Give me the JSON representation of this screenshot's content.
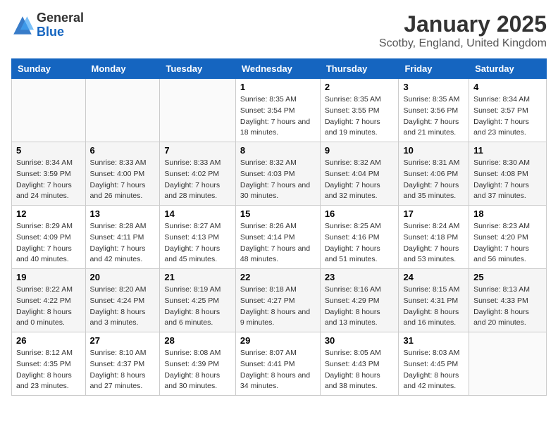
{
  "header": {
    "logo_general": "General",
    "logo_blue": "Blue",
    "title": "January 2025",
    "subtitle": "Scotby, England, United Kingdom"
  },
  "days_of_week": [
    "Sunday",
    "Monday",
    "Tuesday",
    "Wednesday",
    "Thursday",
    "Friday",
    "Saturday"
  ],
  "weeks": [
    [
      {
        "day": "",
        "sunrise": "",
        "sunset": "",
        "daylight": ""
      },
      {
        "day": "",
        "sunrise": "",
        "sunset": "",
        "daylight": ""
      },
      {
        "day": "",
        "sunrise": "",
        "sunset": "",
        "daylight": ""
      },
      {
        "day": "1",
        "sunrise": "Sunrise: 8:35 AM",
        "sunset": "Sunset: 3:54 PM",
        "daylight": "Daylight: 7 hours and 18 minutes."
      },
      {
        "day": "2",
        "sunrise": "Sunrise: 8:35 AM",
        "sunset": "Sunset: 3:55 PM",
        "daylight": "Daylight: 7 hours and 19 minutes."
      },
      {
        "day": "3",
        "sunrise": "Sunrise: 8:35 AM",
        "sunset": "Sunset: 3:56 PM",
        "daylight": "Daylight: 7 hours and 21 minutes."
      },
      {
        "day": "4",
        "sunrise": "Sunrise: 8:34 AM",
        "sunset": "Sunset: 3:57 PM",
        "daylight": "Daylight: 7 hours and 23 minutes."
      }
    ],
    [
      {
        "day": "5",
        "sunrise": "Sunrise: 8:34 AM",
        "sunset": "Sunset: 3:59 PM",
        "daylight": "Daylight: 7 hours and 24 minutes."
      },
      {
        "day": "6",
        "sunrise": "Sunrise: 8:33 AM",
        "sunset": "Sunset: 4:00 PM",
        "daylight": "Daylight: 7 hours and 26 minutes."
      },
      {
        "day": "7",
        "sunrise": "Sunrise: 8:33 AM",
        "sunset": "Sunset: 4:02 PM",
        "daylight": "Daylight: 7 hours and 28 minutes."
      },
      {
        "day": "8",
        "sunrise": "Sunrise: 8:32 AM",
        "sunset": "Sunset: 4:03 PM",
        "daylight": "Daylight: 7 hours and 30 minutes."
      },
      {
        "day": "9",
        "sunrise": "Sunrise: 8:32 AM",
        "sunset": "Sunset: 4:04 PM",
        "daylight": "Daylight: 7 hours and 32 minutes."
      },
      {
        "day": "10",
        "sunrise": "Sunrise: 8:31 AM",
        "sunset": "Sunset: 4:06 PM",
        "daylight": "Daylight: 7 hours and 35 minutes."
      },
      {
        "day": "11",
        "sunrise": "Sunrise: 8:30 AM",
        "sunset": "Sunset: 4:08 PM",
        "daylight": "Daylight: 7 hours and 37 minutes."
      }
    ],
    [
      {
        "day": "12",
        "sunrise": "Sunrise: 8:29 AM",
        "sunset": "Sunset: 4:09 PM",
        "daylight": "Daylight: 7 hours and 40 minutes."
      },
      {
        "day": "13",
        "sunrise": "Sunrise: 8:28 AM",
        "sunset": "Sunset: 4:11 PM",
        "daylight": "Daylight: 7 hours and 42 minutes."
      },
      {
        "day": "14",
        "sunrise": "Sunrise: 8:27 AM",
        "sunset": "Sunset: 4:13 PM",
        "daylight": "Daylight: 7 hours and 45 minutes."
      },
      {
        "day": "15",
        "sunrise": "Sunrise: 8:26 AM",
        "sunset": "Sunset: 4:14 PM",
        "daylight": "Daylight: 7 hours and 48 minutes."
      },
      {
        "day": "16",
        "sunrise": "Sunrise: 8:25 AM",
        "sunset": "Sunset: 4:16 PM",
        "daylight": "Daylight: 7 hours and 51 minutes."
      },
      {
        "day": "17",
        "sunrise": "Sunrise: 8:24 AM",
        "sunset": "Sunset: 4:18 PM",
        "daylight": "Daylight: 7 hours and 53 minutes."
      },
      {
        "day": "18",
        "sunrise": "Sunrise: 8:23 AM",
        "sunset": "Sunset: 4:20 PM",
        "daylight": "Daylight: 7 hours and 56 minutes."
      }
    ],
    [
      {
        "day": "19",
        "sunrise": "Sunrise: 8:22 AM",
        "sunset": "Sunset: 4:22 PM",
        "daylight": "Daylight: 8 hours and 0 minutes."
      },
      {
        "day": "20",
        "sunrise": "Sunrise: 8:20 AM",
        "sunset": "Sunset: 4:24 PM",
        "daylight": "Daylight: 8 hours and 3 minutes."
      },
      {
        "day": "21",
        "sunrise": "Sunrise: 8:19 AM",
        "sunset": "Sunset: 4:25 PM",
        "daylight": "Daylight: 8 hours and 6 minutes."
      },
      {
        "day": "22",
        "sunrise": "Sunrise: 8:18 AM",
        "sunset": "Sunset: 4:27 PM",
        "daylight": "Daylight: 8 hours and 9 minutes."
      },
      {
        "day": "23",
        "sunrise": "Sunrise: 8:16 AM",
        "sunset": "Sunset: 4:29 PM",
        "daylight": "Daylight: 8 hours and 13 minutes."
      },
      {
        "day": "24",
        "sunrise": "Sunrise: 8:15 AM",
        "sunset": "Sunset: 4:31 PM",
        "daylight": "Daylight: 8 hours and 16 minutes."
      },
      {
        "day": "25",
        "sunrise": "Sunrise: 8:13 AM",
        "sunset": "Sunset: 4:33 PM",
        "daylight": "Daylight: 8 hours and 20 minutes."
      }
    ],
    [
      {
        "day": "26",
        "sunrise": "Sunrise: 8:12 AM",
        "sunset": "Sunset: 4:35 PM",
        "daylight": "Daylight: 8 hours and 23 minutes."
      },
      {
        "day": "27",
        "sunrise": "Sunrise: 8:10 AM",
        "sunset": "Sunset: 4:37 PM",
        "daylight": "Daylight: 8 hours and 27 minutes."
      },
      {
        "day": "28",
        "sunrise": "Sunrise: 8:08 AM",
        "sunset": "Sunset: 4:39 PM",
        "daylight": "Daylight: 8 hours and 30 minutes."
      },
      {
        "day": "29",
        "sunrise": "Sunrise: 8:07 AM",
        "sunset": "Sunset: 4:41 PM",
        "daylight": "Daylight: 8 hours and 34 minutes."
      },
      {
        "day": "30",
        "sunrise": "Sunrise: 8:05 AM",
        "sunset": "Sunset: 4:43 PM",
        "daylight": "Daylight: 8 hours and 38 minutes."
      },
      {
        "day": "31",
        "sunrise": "Sunrise: 8:03 AM",
        "sunset": "Sunset: 4:45 PM",
        "daylight": "Daylight: 8 hours and 42 minutes."
      },
      {
        "day": "",
        "sunrise": "",
        "sunset": "",
        "daylight": ""
      }
    ]
  ]
}
